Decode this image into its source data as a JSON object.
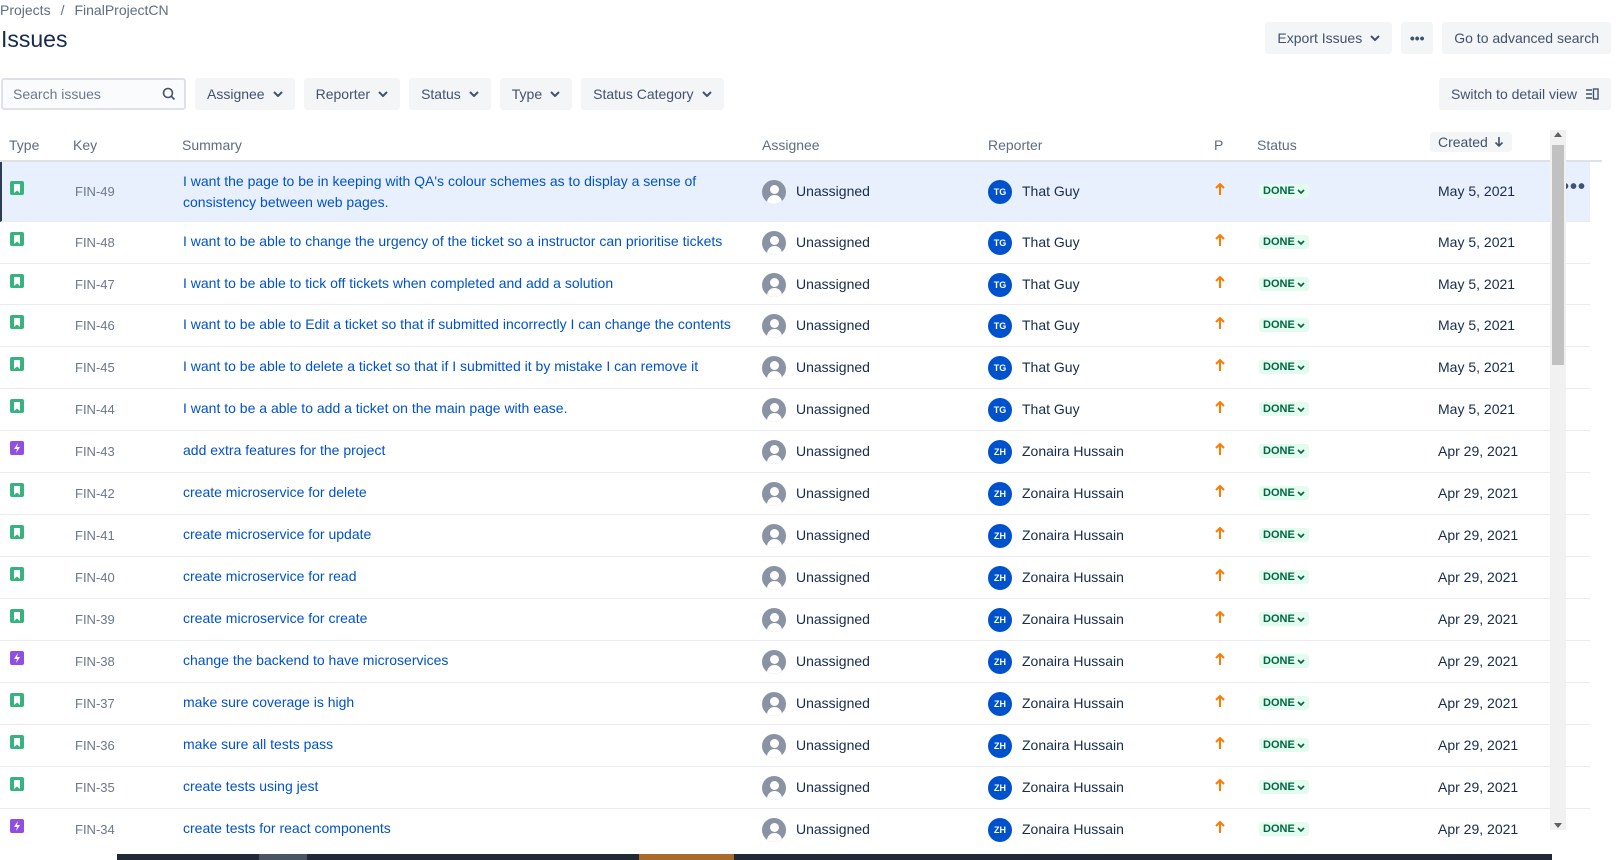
{
  "breadcrumb": {
    "projects": "Projects",
    "separator": "/",
    "project": "FinalProjectCN"
  },
  "page_title": "Issues",
  "top_actions": {
    "export": "Export Issues",
    "more": "•••",
    "advanced": "Go to advanced search"
  },
  "search": {
    "placeholder": "Search issues",
    "value": ""
  },
  "filters": [
    "Assignee",
    "Reporter",
    "Status",
    "Type",
    "Status Category"
  ],
  "switch_view": "Switch to detail view",
  "columns": {
    "type": "Type",
    "key": "Key",
    "summary": "Summary",
    "assignee": "Assignee",
    "reporter": "Reporter",
    "priority": "P",
    "status": "Status",
    "created": "Created"
  },
  "colors": {
    "link": "#0052cc",
    "story": "#36b37e",
    "task": "#904ee2",
    "priority": "#ff7b00",
    "done_bg": "#e3fcef",
    "done_fg": "#006644",
    "avatar": "#0052cc"
  },
  "issues": [
    {
      "type": "story",
      "key": "FIN-49",
      "summary": "I want the page to be in keeping with QA's colour schemes as to display a sense of consistency between web pages.",
      "assignee": "Unassigned",
      "reporter_initials": "TG",
      "reporter": "That Guy",
      "status": "DONE",
      "created": "May 5, 2021"
    },
    {
      "type": "story",
      "key": "FIN-48",
      "summary": "I want to be able to change the urgency of the ticket so a instructor can prioritise tickets",
      "assignee": "Unassigned",
      "reporter_initials": "TG",
      "reporter": "That Guy",
      "status": "DONE",
      "created": "May 5, 2021"
    },
    {
      "type": "story",
      "key": "FIN-47",
      "summary": "I want to be able to tick off tickets when completed and add a solution",
      "assignee": "Unassigned",
      "reporter_initials": "TG",
      "reporter": "That Guy",
      "status": "DONE",
      "created": "May 5, 2021"
    },
    {
      "type": "story",
      "key": "FIN-46",
      "summary": "I want to be able to Edit a ticket so that if submitted incorrectly I can change the contents",
      "assignee": "Unassigned",
      "reporter_initials": "TG",
      "reporter": "That Guy",
      "status": "DONE",
      "created": "May 5, 2021"
    },
    {
      "type": "story",
      "key": "FIN-45",
      "summary": "I want to be able to delete a ticket so that if I submitted it by mistake I can remove it",
      "assignee": "Unassigned",
      "reporter_initials": "TG",
      "reporter": "That Guy",
      "status": "DONE",
      "created": "May 5, 2021"
    },
    {
      "type": "story",
      "key": "FIN-44",
      "summary": "I want to be a able to add a ticket on the main page with ease.",
      "assignee": "Unassigned",
      "reporter_initials": "TG",
      "reporter": "That Guy",
      "status": "DONE",
      "created": "May 5, 2021"
    },
    {
      "type": "task",
      "key": "FIN-43",
      "summary": "add extra features for the project",
      "assignee": "Unassigned",
      "reporter_initials": "ZH",
      "reporter": "Zonaira Hussain",
      "status": "DONE",
      "created": "Apr 29, 2021"
    },
    {
      "type": "story",
      "key": "FIN-42",
      "summary": "create microservice for delete",
      "assignee": "Unassigned",
      "reporter_initials": "ZH",
      "reporter": "Zonaira Hussain",
      "status": "DONE",
      "created": "Apr 29, 2021"
    },
    {
      "type": "story",
      "key": "FIN-41",
      "summary": "create microservice for update",
      "assignee": "Unassigned",
      "reporter_initials": "ZH",
      "reporter": "Zonaira Hussain",
      "status": "DONE",
      "created": "Apr 29, 2021"
    },
    {
      "type": "story",
      "key": "FIN-40",
      "summary": "create microservice for read",
      "assignee": "Unassigned",
      "reporter_initials": "ZH",
      "reporter": "Zonaira Hussain",
      "status": "DONE",
      "created": "Apr 29, 2021"
    },
    {
      "type": "story",
      "key": "FIN-39",
      "summary": "create microservice for create",
      "assignee": "Unassigned",
      "reporter_initials": "ZH",
      "reporter": "Zonaira Hussain",
      "status": "DONE",
      "created": "Apr 29, 2021"
    },
    {
      "type": "task",
      "key": "FIN-38",
      "summary": "change the backend to have microservices",
      "assignee": "Unassigned",
      "reporter_initials": "ZH",
      "reporter": "Zonaira Hussain",
      "status": "DONE",
      "created": "Apr 29, 2021"
    },
    {
      "type": "story",
      "key": "FIN-37",
      "summary": "make sure coverage is high",
      "assignee": "Unassigned",
      "reporter_initials": "ZH",
      "reporter": "Zonaira Hussain",
      "status": "DONE",
      "created": "Apr 29, 2021"
    },
    {
      "type": "story",
      "key": "FIN-36",
      "summary": "make sure all tests pass",
      "assignee": "Unassigned",
      "reporter_initials": "ZH",
      "reporter": "Zonaira Hussain",
      "status": "DONE",
      "created": "Apr 29, 2021"
    },
    {
      "type": "story",
      "key": "FIN-35",
      "summary": "create tests using jest",
      "assignee": "Unassigned",
      "reporter_initials": "ZH",
      "reporter": "Zonaira Hussain",
      "status": "DONE",
      "created": "Apr 29, 2021"
    },
    {
      "type": "task",
      "key": "FIN-34",
      "summary": "create tests for react components",
      "assignee": "Unassigned",
      "reporter_initials": "ZH",
      "reporter": "Zonaira Hussain",
      "status": "DONE",
      "created": "Apr 29, 2021"
    }
  ]
}
